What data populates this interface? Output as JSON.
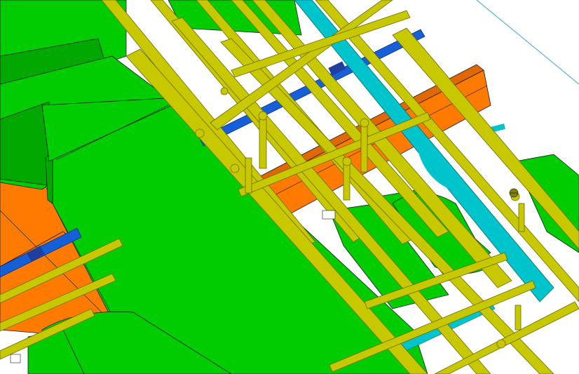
{
  "view": {
    "kind": "3d-mep-coordination-model",
    "colors": {
      "background": "#ffffff",
      "duct_green": "#00cc00",
      "duct_green_dark": "#00a800",
      "tray_orange": "#ff7a00",
      "pipe_yellow": "#c8c800",
      "pipe_yellow_dark": "#9a9a00",
      "pipe_blue": "#1560d8",
      "pipe_cyan": "#00c4cc",
      "edge_line": "#1a1a1a",
      "section_line": "#3aa0d8"
    }
  }
}
